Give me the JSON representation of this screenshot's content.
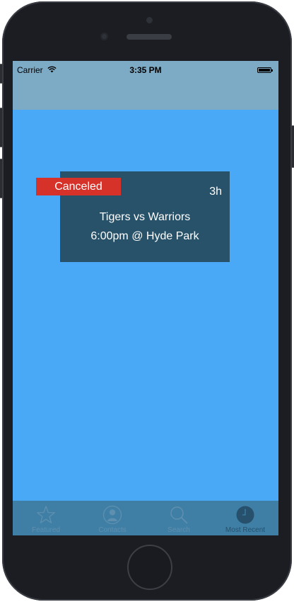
{
  "status_bar": {
    "carrier": "Carrier",
    "time": "3:35 PM"
  },
  "event": {
    "status_badge": "Canceled",
    "time_ago": "3h",
    "title": "Tigers vs Warriors",
    "detail": "6:00pm @ Hyde Park"
  },
  "tab_bar": {
    "tabs": [
      {
        "label": "Featured",
        "icon": "star-icon"
      },
      {
        "label": "Contacts",
        "icon": "contacts-icon"
      },
      {
        "label": "Search",
        "icon": "search-icon"
      },
      {
        "label": "Most Recent",
        "icon": "clock-icon"
      }
    ],
    "selected": "Most Recent"
  },
  "colors": {
    "screen_bg": "#49a9f7",
    "nav_bg": "#7daac5",
    "card_bg": "#285269",
    "badge_bg": "#d6322a",
    "tab_bar_bg": "#3f7fa6"
  }
}
